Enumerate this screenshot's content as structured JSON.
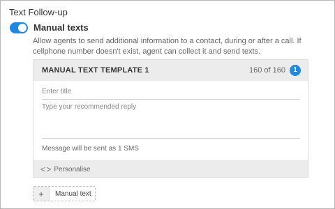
{
  "section": {
    "title": "Text Follow-up"
  },
  "toggle": {
    "label": "Manual texts",
    "on": true,
    "color": "#1e88e5"
  },
  "description": "Allow agents to send additional information to a contact, during or after a call. If cellphone number doesn't exist, agent can collect it and send texts.",
  "template": {
    "title": "MANUAL TEXT TEMPLATE 1",
    "char_count": "160 of 160",
    "badge": "1",
    "title_placeholder": "Enter title",
    "reply_placeholder": "Type your recommended reply",
    "sms_note": "Message will be sent as 1 SMS",
    "personalise_label": "Personalise",
    "personalise_icon": "code-brackets-icon"
  },
  "add_button": {
    "icon": "plus-icon",
    "label": "Manual text"
  }
}
